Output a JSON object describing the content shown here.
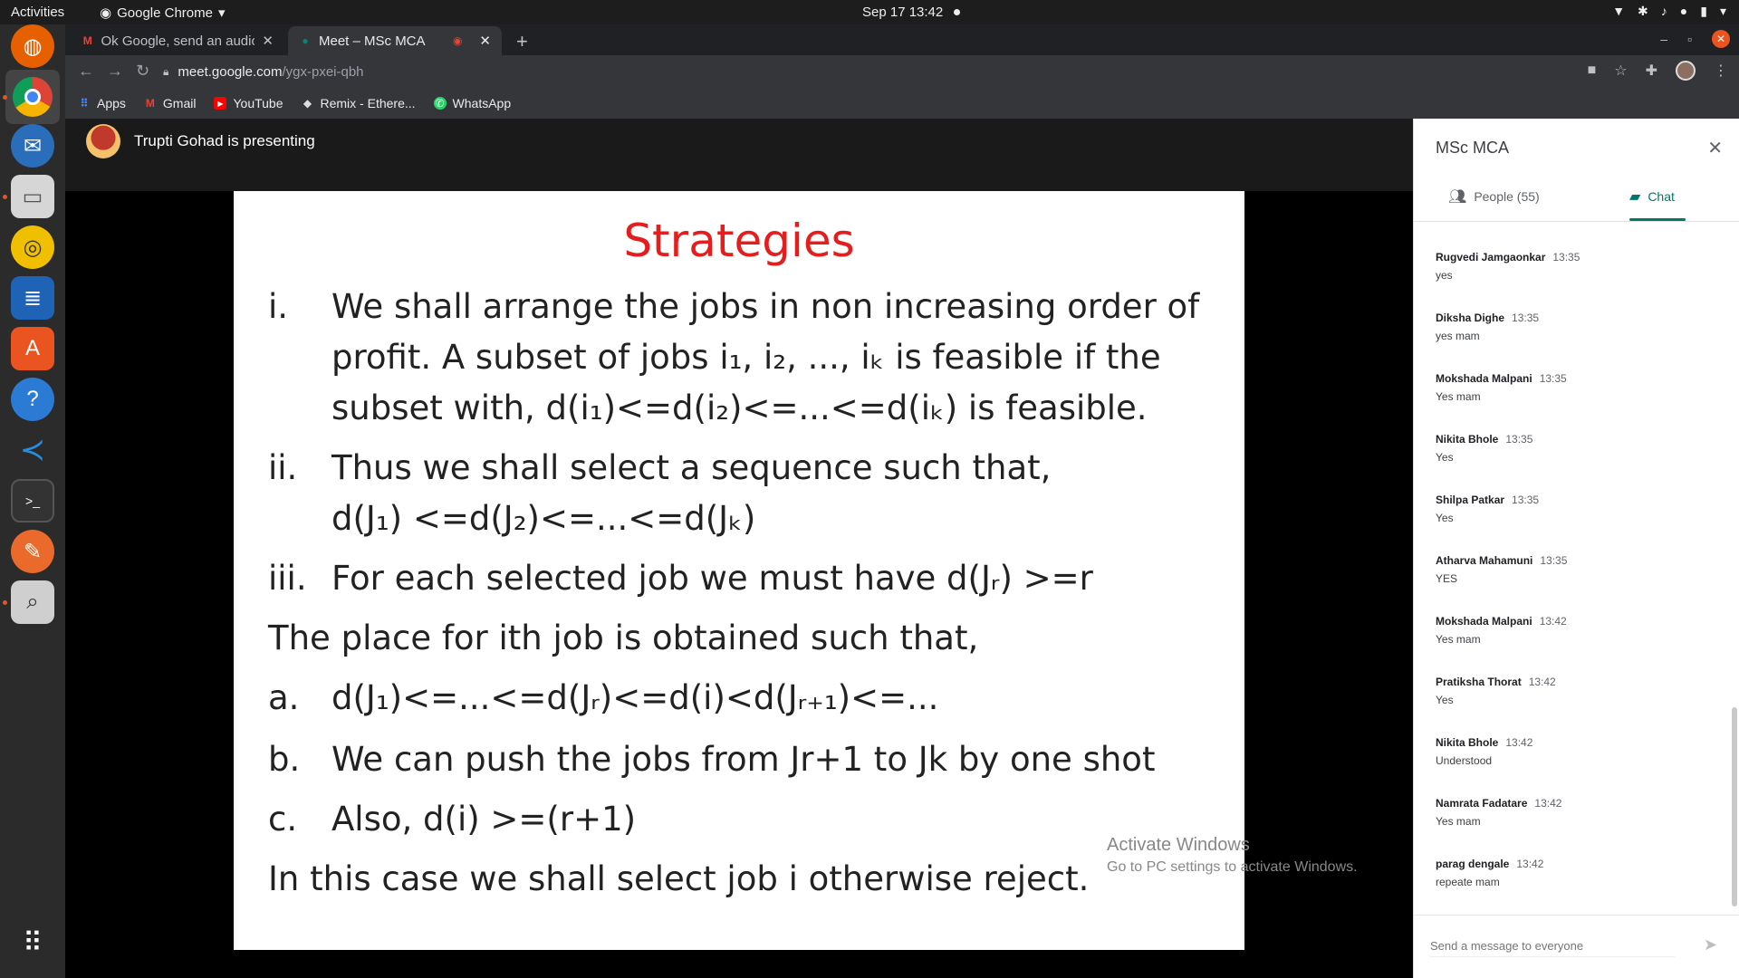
{
  "topbar": {
    "activities": "Activities",
    "app_name": "Google Chrome",
    "clock": "Sep 17  13:42"
  },
  "browser": {
    "tabs": [
      {
        "title": "Ok Google, send an audio"
      },
      {
        "title": "Meet – MSc MCA"
      }
    ],
    "url_host": "meet.google.com",
    "url_path": "/ygx-pxei-qbh",
    "bookmarks": [
      "Apps",
      "Gmail",
      "YouTube",
      "Remix - Ethere...",
      "WhatsApp"
    ]
  },
  "meet": {
    "presenting_text": "Trupti Gohad is presenting",
    "slide": {
      "title": "Strategies",
      "lines": [
        {
          "label": "i.",
          "text": "We shall arrange the jobs in non increasing order of"
        },
        {
          "label": "",
          "text": "profit. A subset of jobs i₁, i₂, ..., iₖ is feasible if the"
        },
        {
          "label": "",
          "text": "subset with, d(i₁)<=d(i₂)<=...<=d(iₖ) is feasible."
        },
        {
          "label": "ii.",
          "text": "Thus we shall select a sequence such that,"
        },
        {
          "label": "",
          "text": "d(J₁) <=d(J₂)<=...<=d(Jₖ)"
        },
        {
          "label": "iii.",
          "text": "For each selected job we must have d(Jᵣ) >=r"
        },
        {
          "label": "",
          "text": "The place for ith job is obtained such that,"
        },
        {
          "label": "a.",
          "text": "d(J₁)<=...<=d(Jᵣ)<=d(i)<d(Jᵣ₊₁)<=..."
        },
        {
          "label": "b.",
          "text": "We can push the jobs from Jr+1 to Jk by one shot"
        },
        {
          "label": "c.",
          "text": "Also, d(i) >=(r+1)"
        },
        {
          "label": "",
          "text": "In this case we shall select job i otherwise reject."
        }
      ]
    },
    "watermark": {
      "line1": "Activate Windows",
      "line2": "Go to PC settings to activate Windows."
    }
  },
  "panel": {
    "title": "MSc MCA",
    "tabs": {
      "people": "People (55)",
      "chat": "Chat"
    },
    "messages": [
      {
        "name": "Rugvedi Jamgaonkar",
        "time": "13:35",
        "text": "yes"
      },
      {
        "name": "Diksha Dighe",
        "time": "13:35",
        "text": "yes mam"
      },
      {
        "name": "Mokshada Malpani",
        "time": "13:35",
        "text": "Yes mam"
      },
      {
        "name": "Nikita Bhole",
        "time": "13:35",
        "text": "Yes"
      },
      {
        "name": "Shilpa Patkar",
        "time": "13:35",
        "text": "Yes"
      },
      {
        "name": "Atharva Mahamuni",
        "time": "13:35",
        "text": "YES"
      },
      {
        "name": "Mokshada Malpani",
        "time": "13:42",
        "text": "Yes mam"
      },
      {
        "name": "Pratiksha Thorat",
        "time": "13:42",
        "text": "Yes"
      },
      {
        "name": "Nikita Bhole",
        "time": "13:42",
        "text": "Understood"
      },
      {
        "name": "Namrata Fadatare",
        "time": "13:42",
        "text": "Yes mam"
      },
      {
        "name": "parag dengale",
        "time": "13:42",
        "text": "repeate mam"
      }
    ],
    "compose_placeholder": "Send a message to everyone"
  },
  "colors": {
    "slide_title": "#e41e1e",
    "chat_accent": "#00796b",
    "ubuntu_orange": "#e95420"
  }
}
